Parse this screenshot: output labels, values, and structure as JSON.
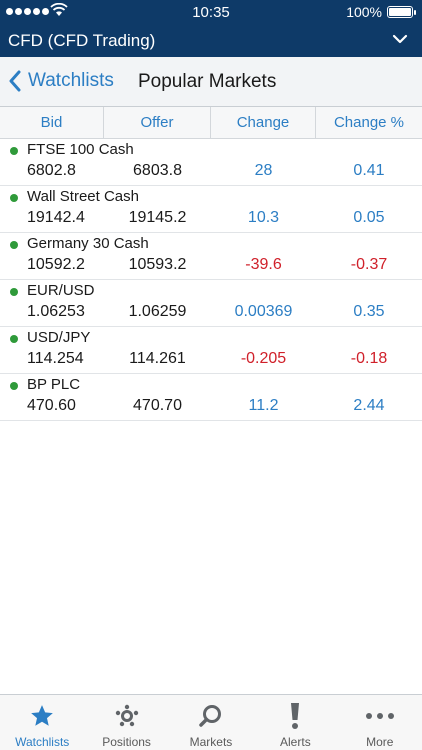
{
  "status": {
    "time": "10:35",
    "battery": "100%"
  },
  "app": {
    "title": "CFD (CFD Trading)"
  },
  "nav": {
    "back_label": "Watchlists",
    "page_title": "Popular Markets"
  },
  "columns": {
    "bid": "Bid",
    "offer": "Offer",
    "change": "Change",
    "change_pct": "Change %"
  },
  "markets": [
    {
      "name": "FTSE 100 Cash",
      "bid": "6802.8",
      "offer": "6803.8",
      "change": "28",
      "change_pct": "0.41",
      "direction": "up"
    },
    {
      "name": "Wall Street Cash",
      "bid": "19142.4",
      "offer": "19145.2",
      "change": "10.3",
      "change_pct": "0.05",
      "direction": "up"
    },
    {
      "name": "Germany 30 Cash",
      "bid": "10592.2",
      "offer": "10593.2",
      "change": "-39.6",
      "change_pct": "-0.37",
      "direction": "down"
    },
    {
      "name": "EUR/USD",
      "bid": "1.06253",
      "offer": "1.06259",
      "change": "0.00369",
      "change_pct": "0.35",
      "direction": "up"
    },
    {
      "name": "USD/JPY",
      "bid": "114.254",
      "offer": "114.261",
      "change": "-0.205",
      "change_pct": "-0.18",
      "direction": "down"
    },
    {
      "name": "BP PLC",
      "bid": "470.60",
      "offer": "470.70",
      "change": "11.2",
      "change_pct": "2.44",
      "direction": "up"
    }
  ],
  "tabs": [
    {
      "label": "Watchlists",
      "icon": "star-icon",
      "active": true
    },
    {
      "label": "Positions",
      "icon": "positions-icon",
      "active": false
    },
    {
      "label": "Markets",
      "icon": "search-icon",
      "active": false
    },
    {
      "label": "Alerts",
      "icon": "exclamation-icon",
      "active": false
    },
    {
      "label": "More",
      "icon": "more-dots-icon",
      "active": false
    }
  ],
  "colors": {
    "header_bg": "#0e3a68",
    "accent": "#2c7ec4",
    "negative": "#d0202a",
    "live_dot": "#2f9a3a"
  }
}
